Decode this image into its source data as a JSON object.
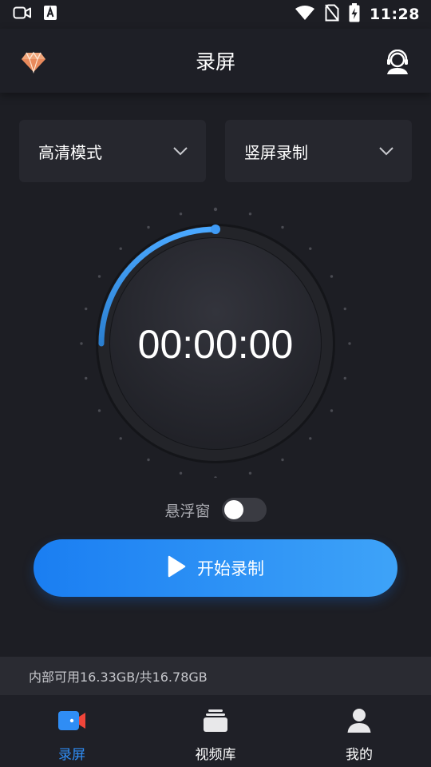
{
  "status_bar": {
    "time": "11:28",
    "icons": [
      "video-camera-icon",
      "keyboard-a-icon",
      "wifi-icon",
      "no-sim-icon",
      "battery-charging-icon"
    ]
  },
  "app_bar": {
    "title": "录屏",
    "left_icon": "diamond-icon",
    "right_icon": "customer-support-icon"
  },
  "settings": {
    "quality": {
      "label": "高清模式"
    },
    "orientation": {
      "label": "竖屏录制"
    }
  },
  "timer": {
    "value": "00:00:00",
    "progress_fraction": 0.25
  },
  "floating_window": {
    "label": "悬浮窗",
    "enabled": false
  },
  "record_button": {
    "label": "开始录制"
  },
  "storage": {
    "text": "内部可用16.33GB/共16.78GB"
  },
  "bottom_nav": {
    "items": [
      {
        "label": "录屏",
        "icon": "screen-record-icon",
        "active": true
      },
      {
        "label": "视频库",
        "icon": "video-library-icon",
        "active": false
      },
      {
        "label": "我的",
        "icon": "profile-icon",
        "active": false
      }
    ]
  },
  "colors": {
    "accent": "#2f8df5",
    "background": "#1d1e24",
    "card": "#26272e"
  }
}
